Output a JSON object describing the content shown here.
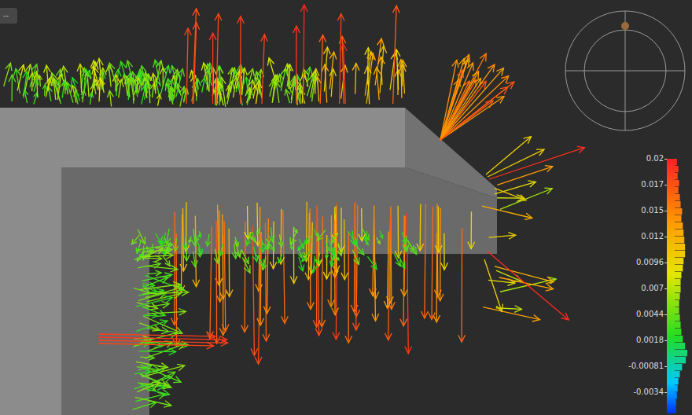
{
  "toolbar": {
    "button": "--"
  },
  "legend": {
    "ticks": [
      "0.02",
      "0.017",
      "0.015",
      "0.012",
      "0.0096",
      "0.007",
      "0.0044",
      "0.0018",
      "-0.00081",
      "-0.0034"
    ],
    "histogram": [
      3,
      5,
      4,
      6,
      5,
      7,
      8,
      10,
      9,
      11,
      12,
      13,
      14,
      14,
      12,
      11,
      9,
      8,
      8,
      7,
      6,
      6,
      7,
      8,
      9,
      11,
      14,
      17,
      15,
      10,
      7,
      5,
      4,
      3,
      2,
      2
    ]
  },
  "gizmo": {
    "level": 0.5
  }
}
